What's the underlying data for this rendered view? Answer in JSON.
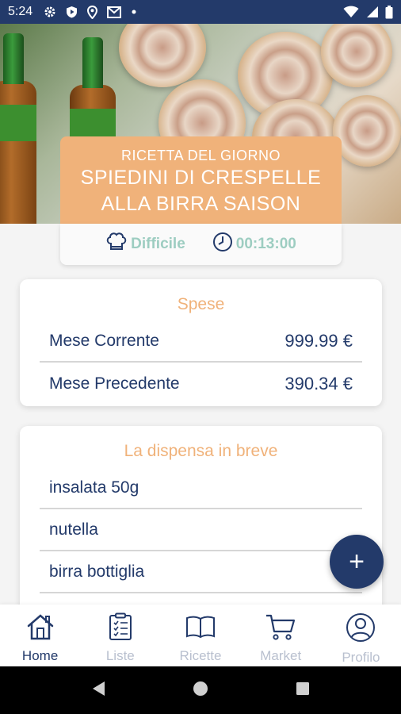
{
  "status_bar": {
    "time": "5:24"
  },
  "recipe": {
    "kicker": "RICETTA DEL GIORNO",
    "title_line1": "SPIEDINI DI CRESPELLE",
    "title_line2": "ALLA BIRRA SAISON",
    "difficulty": "Difficile",
    "duration": "00:13:00"
  },
  "expenses": {
    "title": "Spese",
    "rows": [
      {
        "label": "Mese Corrente",
        "amount": "999.99 €"
      },
      {
        "label": "Mese Precedente",
        "amount": "390.34 €"
      }
    ]
  },
  "pantry": {
    "title": "La dispensa in breve",
    "items": [
      "insalata 50g",
      "nutella",
      "birra bottiglia"
    ]
  },
  "fab": {
    "label": "+"
  },
  "nav": {
    "items": [
      {
        "label": "Home",
        "icon": "home-icon",
        "active": true
      },
      {
        "label": "Liste",
        "icon": "clipboard-list-icon",
        "active": false
      },
      {
        "label": "Ricette",
        "icon": "book-icon",
        "active": false
      },
      {
        "label": "Market",
        "icon": "cart-icon",
        "active": false
      },
      {
        "label": "Profilo",
        "icon": "user-icon",
        "active": false
      }
    ]
  },
  "colors": {
    "primary": "#233a6a",
    "accent": "#f0b27a",
    "teal": "#9dcdc1",
    "inactive": "#b9c0cf"
  }
}
